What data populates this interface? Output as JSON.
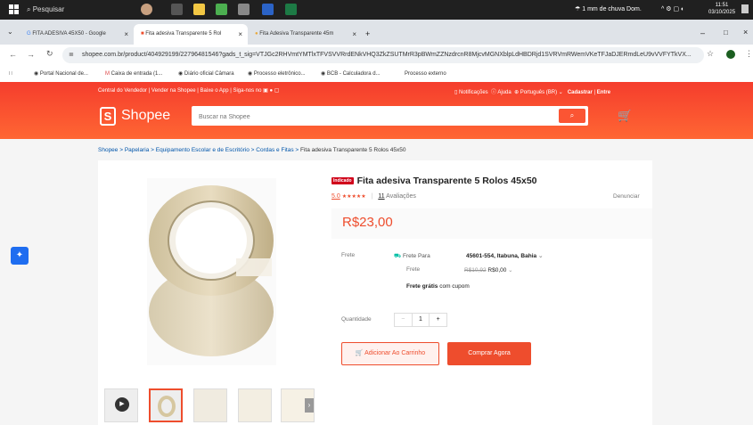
{
  "taskbar": {
    "search_label": "Pesquisar",
    "weather": "1 mm de chuva Dom.",
    "time": "11:51",
    "date": "03/10/2025"
  },
  "browser": {
    "tabs": [
      {
        "label": "FITA ADESIVA 45X50 - Google"
      },
      {
        "label": "Fita adesiva Transparente 5 Rol"
      },
      {
        "label": "Fita Adesiva Transparente 45m"
      }
    ],
    "new_tab": "+",
    "url": "shopee.com.br/product/404929199/22796481546?gads_t_sig=VTJGc2RHVmtYMTlxTFVSVVRrdENkVHQ3ZkZSUTMrR3pBWmZZNzdrcnR8MjcvMGNXblpLdHBDRjd1SVRVmRWemVKeTFJaDJERmdLeU9vVVFYTkVX...",
    "bookmarks": [
      "Portal Nacional de...",
      "Caixa de entrada (1...",
      "Diário oficial Câmara",
      "Processo eletrônico...",
      "BCB - Calculadora d...",
      "Processo externo"
    ]
  },
  "header": {
    "links": "Central do Vendedor | Vender na Shopee | Baixe o App | Siga-nos no",
    "notifications": "Notificações",
    "help": "Ajuda",
    "language": "Português (BR)",
    "register": "Cadastrar",
    "login": "Entre",
    "logo_text": "Shopee",
    "search_placeholder": "Buscar na Shopee"
  },
  "breadcrumb": {
    "items": [
      "Shopee",
      "Papelaria",
      "Equipamento Escolar e de Escritório",
      "Cordas e Fitas"
    ],
    "current": "Fita adesiva Transparente 5 Rolos 45x50"
  },
  "product": {
    "badge": "Indicado",
    "title": "Fita adesiva Transparente 5 Rolos 45x50",
    "rating": "5.0",
    "stars": "★★★★★",
    "reviews_count": "11",
    "reviews_label": "Avaliações",
    "report": "Denunciar",
    "price": "R$23,00",
    "shipping_label": "Frete",
    "shipping_to_label": "Frete Para",
    "shipping_to": "45601-554, Itabuna, Bahia",
    "freight_label": "Frete",
    "freight_old": "R$10,92",
    "freight_new": "R$0,00",
    "free_shipping": "Frete grátis",
    "free_shipping_suffix": "com cupom",
    "quantity_label": "Quantidade",
    "quantity": "1",
    "minus": "−",
    "plus": "+",
    "add_to_cart": "Adicionar Ao Carrinho",
    "buy_now": "Comprar Agora"
  },
  "colors": {
    "brand": "#ee4d2d",
    "header_bg": "#f53d2d"
  }
}
